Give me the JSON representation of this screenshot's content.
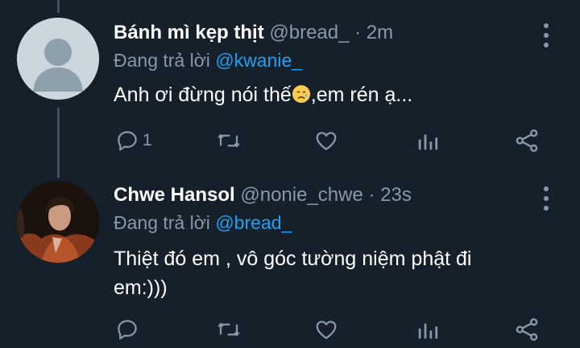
{
  "tweets": [
    {
      "display_name": "Bánh mì kẹp thịt",
      "handle": "@bread_",
      "separator": "·",
      "time": "2m",
      "reply_prefix": "Đang trả lời",
      "reply_to": "@kwanie_",
      "text_before_emoji": "Anh ơi đừng nói thế",
      "emoji": "disappointed-relieved-emoji",
      "text_after_emoji": ",em rén ạ...",
      "reply_count": "1",
      "avatar": "default-avatar"
    },
    {
      "display_name": "Chwe Hansol",
      "handle": "@nonie_chwe",
      "separator": "·",
      "time": "23s",
      "reply_prefix": "Đang trả lời",
      "reply_to": "@bread_",
      "text_line1": "Thiệt đó em , vô góc tường niệm phật đi",
      "text_line2": "em:)))",
      "reply_count": "",
      "avatar": "profile-photo"
    }
  ],
  "colors": {
    "background": "#15202b",
    "secondary_text": "#8899a6",
    "mention": "#1da1f2",
    "thread_line": "#3d5466"
  }
}
